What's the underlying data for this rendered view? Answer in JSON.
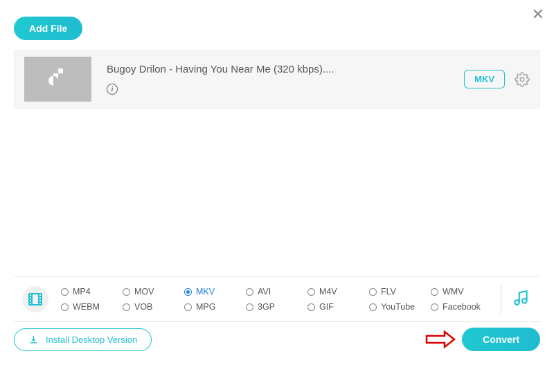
{
  "header": {
    "add_file_label": "Add File"
  },
  "file": {
    "title": "Bugoy Drilon - Having You Near Me (320 kbps)....",
    "format_badge": "MKV"
  },
  "formats": {
    "row1": [
      "MP4",
      "MOV",
      "MKV",
      "AVI",
      "M4V",
      "FLV",
      "WMV"
    ],
    "row2": [
      "WEBM",
      "VOB",
      "MPG",
      "3GP",
      "GIF",
      "YouTube",
      "Facebook"
    ],
    "selected": "MKV"
  },
  "footer": {
    "install_label": "Install Desktop Version",
    "convert_label": "Convert"
  },
  "colors": {
    "accent": "#1fc3d0"
  }
}
